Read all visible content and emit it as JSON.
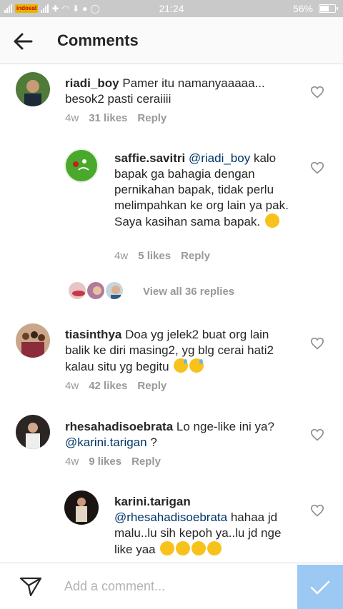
{
  "status_bar": {
    "carrier": "indosat",
    "time": "21:24",
    "battery": "56%",
    "battery_level": 0.56
  },
  "header": {
    "title": "Comments",
    "back_icon": "arrow-left-icon"
  },
  "comments": [
    {
      "username": "riadi_boy",
      "text": "Pamer itu namanyaaaaa... besok2 pasti ceraiiii",
      "time": "4w",
      "likes": "31 likes",
      "reply": "Reply"
    },
    {
      "username": "saffie.savitri",
      "mention": "@riadi_boy",
      "text": "kalo bapak ga bahagia dengan pernikahan bapak, tidak perlu melimpahkan ke org lain ya pak. Saya kasihan sama bapak.",
      "emoji": "upside-down-face",
      "time": "4w",
      "likes": "5 likes",
      "reply": "Reply"
    },
    {
      "username": "tiasinthya",
      "text": "Doa yg jelek2 buat org lain balik ke diri masing2, yg blg cerai hati2 kalau situ yg begitu",
      "emoji": "grinning-sweat x2",
      "time": "4w",
      "likes": "42 likes",
      "reply": "Reply"
    },
    {
      "username": "rhesahadisoebrata",
      "text": "Lo nge-like ini ya?",
      "mention": "@karini.tarigan",
      "text_after": "?",
      "time": "4w",
      "likes": "9 likes",
      "reply": "Reply"
    },
    {
      "username": "karini.tarigan",
      "mention": "@rhesahadisoebrata",
      "text": "hahaa jd malu..lu sih kepoh ya..lu jd nge like yaa",
      "emoji": "zany + squinting-tongue x3"
    }
  ],
  "view_replies": "View all 36 replies",
  "composer": {
    "placeholder": "Add a comment...",
    "send_icon": "direct-send-icon",
    "post_icon": "checkmark-icon"
  },
  "colors": {
    "mention": "#003569",
    "meta": "#999999",
    "post_button": "#9cc9f3",
    "header_bg": "#fafafa"
  }
}
